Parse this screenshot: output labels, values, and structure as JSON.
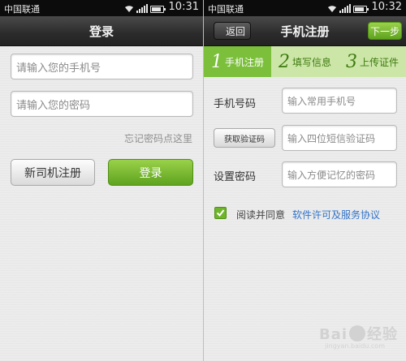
{
  "login_screen": {
    "status": {
      "carrier": "中国联通",
      "time": "10:31"
    },
    "title": "登录",
    "phone_placeholder": "请输入您的手机号",
    "password_placeholder": "请输入您的密码",
    "forgot_link": "忘记密码点这里",
    "register_button": "新司机注册",
    "login_button": "登录"
  },
  "register_screen": {
    "status": {
      "carrier": "中国联通",
      "time": "10:32"
    },
    "back_button": "返回",
    "title": "手机注册",
    "next_button": "下一步",
    "steps": [
      {
        "num": "1",
        "label": "手机注册",
        "active": true
      },
      {
        "num": "2",
        "label": "填写信息",
        "active": false
      },
      {
        "num": "3",
        "label": "上传证件",
        "active": false
      }
    ],
    "phone_label": "手机号码",
    "phone_placeholder": "输入常用手机号",
    "get_code_button": "获取验证码",
    "code_placeholder": "输入四位短信验证码",
    "password_label": "设置密码",
    "password_placeholder": "输入方便记忆的密码",
    "agree_checked": true,
    "agree_text": "阅读并同意",
    "license_link": "软件许可及服务协议"
  },
  "watermark": {
    "text": "Bai",
    "text2": "经验",
    "sub": "jingyan.baidu.com"
  },
  "colors": {
    "accent_green": "#6fb52b",
    "link_blue": "#3173c9",
    "step_bar": "#cce6a8"
  }
}
